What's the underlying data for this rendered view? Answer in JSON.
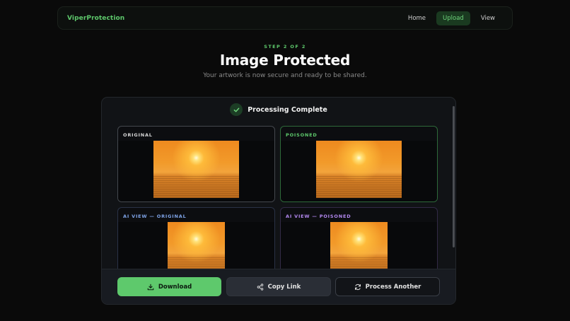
{
  "nav": {
    "brand": "ViperProtection",
    "links": [
      "Home",
      "Upload",
      "View"
    ],
    "active": "Upload"
  },
  "header": {
    "step": "STEP 2 OF 2",
    "title": "Image Protected",
    "subtitle": "Your artwork is now secure and ready to be shared."
  },
  "status": {
    "text": "Processing Complete",
    "icon": "check-icon"
  },
  "panels": [
    {
      "label": "ORIGINAL"
    },
    {
      "label": "POISONED"
    },
    {
      "label": "AI VIEW — ORIGINAL"
    },
    {
      "label": "AI VIEW — POISONED"
    }
  ],
  "actions": {
    "download": "Download",
    "copy_link": "Copy Link",
    "process_another": "Process Another"
  },
  "colors": {
    "accent": "#5ec96c",
    "background": "#0a0a0a",
    "ai_original_label": "#7fa4e8",
    "ai_poisoned_label": "#b388f0"
  }
}
